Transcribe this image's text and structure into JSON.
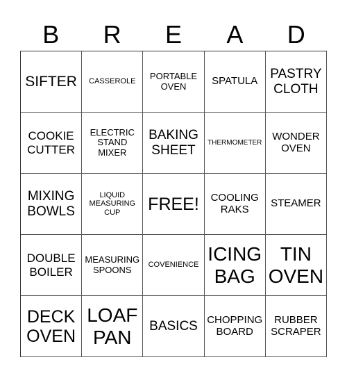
{
  "title_letters": [
    "B",
    "R",
    "E",
    "A",
    "D"
  ],
  "cells": [
    [
      "SIFTER",
      "CASSEROLE",
      "PORTABLE\nOVEN",
      "SPATULA",
      "PASTRY\nCLOTH"
    ],
    [
      "COOKIE\nCUTTER",
      "ELECTRIC\nSTAND\nMIXER",
      "BAKING\nSHEET",
      "THERMOMETER",
      "WONDER\nOVEN"
    ],
    [
      "MIXING\nBOWLS",
      "LIQUID\nMEASURING\nCUP",
      "FREE!",
      "COOLING\nRAKS",
      "STEAMER"
    ],
    [
      "DOUBLE\nBOILER",
      "MEASURING\nSPOONS",
      "COVENIENCE",
      "ICING\nBAG",
      "TIN\nOVEN"
    ],
    [
      "DECK\nOVEN",
      "LOAF\nPAN",
      "BASICS",
      "CHOPPING\nBOARD",
      "RUBBER\nSCRAPER"
    ]
  ]
}
